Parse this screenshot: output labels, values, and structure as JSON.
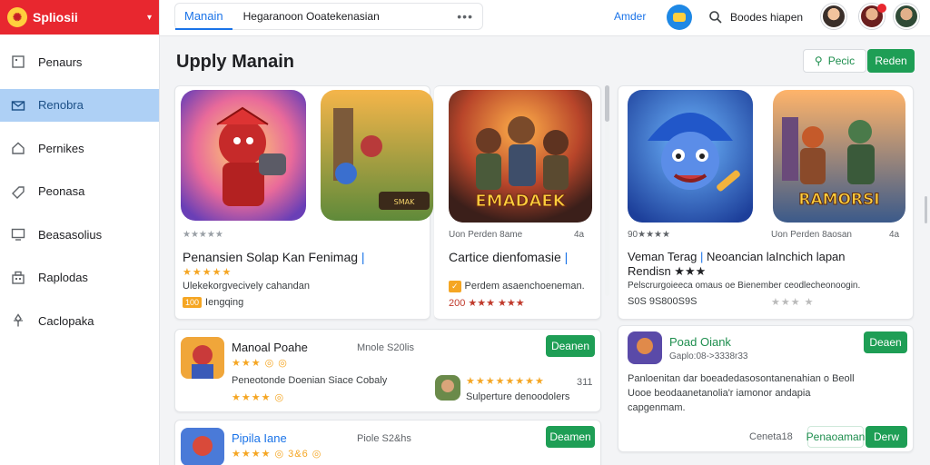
{
  "brand": {
    "name": "Spliosii",
    "logo_glyph": "✺"
  },
  "sidebar": {
    "items": [
      {
        "label": "Penaurs",
        "icon": "square-icon"
      },
      {
        "label": "Renobra",
        "icon": "mail-icon",
        "active": true
      },
      {
        "label": "Pernikes",
        "icon": "home-icon"
      },
      {
        "label": "Peonasa",
        "icon": "tag-icon"
      },
      {
        "label": "Beasasolius",
        "icon": "monitor-icon"
      },
      {
        "label": "Raplodas",
        "icon": "building-icon"
      },
      {
        "label": "Caclopaka",
        "icon": "pin-icon"
      }
    ]
  },
  "topbar": {
    "tab_main": "Manain",
    "tab_sub": "Hegaranoon Ooatekenasian",
    "more": "•••",
    "link": "Amder",
    "search_text": "Boodes hiapen"
  },
  "header": {
    "title": "Upply Manain",
    "btn_outline": "Pecic",
    "btn_primary": "Reden"
  },
  "featured": [
    {
      "meta_left": "★★★★★",
      "meta_right": "",
      "title": "Penansien Solap Kan Fenimag",
      "stars": "★★★★★",
      "desc": "Ulekekorgvecively cahandan",
      "tag": "100",
      "tag_text": "Iengqing"
    },
    {
      "meta_left": "Uon Perden 8ame",
      "meta_right": "4a",
      "title": "Cartice dienfomasie",
      "stars": "",
      "desc": "Perdem asaenchoeneman.",
      "tag": "",
      "tag_text": "200 ★★★ ★★★",
      "art_text": "EMADAEK"
    },
    {
      "meta_left": "90★★★★",
      "meta_right": "",
      "title": "Veman Terag",
      "title_b": "Neoancian laInchich lapan",
      "title_c": "Rendisn ★★★",
      "desc": "Pelscrurgoieeca omaus oe Bienember ceodlecheonoogin.",
      "tag_text": "S0S 9S800S9S"
    },
    {
      "meta_left": "Uon Perden 8aosan",
      "meta_right": "4a",
      "art_text": "RAMORSI",
      "stars": "★★★ ★"
    }
  ],
  "list_cards": [
    {
      "name": "Manoal Poahe",
      "info": "Mnole S20lis",
      "stars": "★★★ ◎ ◎",
      "desc": "Peneotonde Doenian Siace Cobaly",
      "stars2": "★★★★ ◎",
      "sub_stars": "★★★★★★★★",
      "sub_num": "311",
      "sub_desc": "Sulperture denoodolers",
      "button": "Deanen"
    },
    {
      "name": "Pipila Iane",
      "info": "Piole S2&hs",
      "stars": "★★★★ ◎ 3&6 ◎",
      "button": "Deamen"
    }
  ],
  "right_card": {
    "name": "Poad Oiank",
    "sub": "Gaplo:08->3338r33",
    "button": "Deaen",
    "desc1": "Panloenitan dar boeadedasosontanenahian o Beoll",
    "desc2": "Uooe beodaanetanolia'r iamonor andapia",
    "desc3": "capgenmam.",
    "footer_num": "Ceneta18",
    "footer_btn_outline": "Penaoaman",
    "footer_btn": "Derw"
  },
  "colors": {
    "brand": "#e8272f",
    "accent": "#1a73e8",
    "primary": "#1e9e55",
    "active_nav": "#aed0f5"
  }
}
